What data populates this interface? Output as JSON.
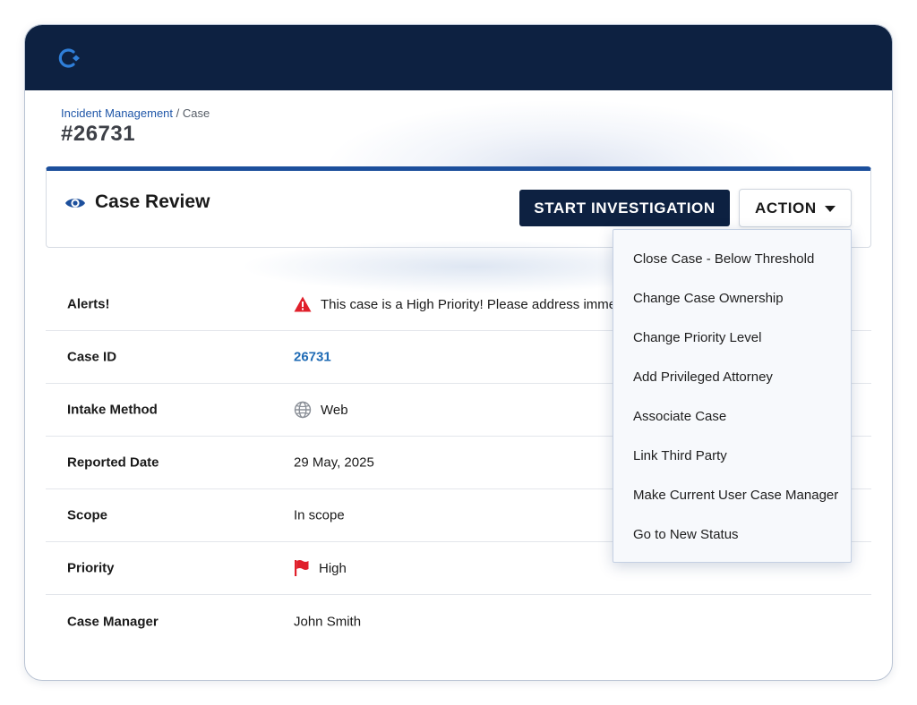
{
  "breadcrumb": {
    "parent": "Incident Management",
    "separator": "/",
    "current": "Case"
  },
  "page": {
    "title": "#26731"
  },
  "card": {
    "title": "Case Review",
    "start_label": "START INVESTIGATION",
    "action_label": "ACTION"
  },
  "fields": [
    {
      "label": "Alerts!",
      "value": "This case is a High Priority! Please address immediately.",
      "icon": "warning-triangle-icon"
    },
    {
      "label": "Case ID",
      "value": "26731",
      "icon": ""
    },
    {
      "label": "Intake Method",
      "value": "Web",
      "icon": "globe-icon"
    },
    {
      "label": "Reported Date",
      "value": "29 May, 2025",
      "icon": ""
    },
    {
      "label": "Scope",
      "value": "In scope",
      "icon": ""
    },
    {
      "label": "Priority",
      "value": "High",
      "icon": "flag-icon"
    },
    {
      "label": "Case Manager",
      "value": "John Smith",
      "icon": ""
    }
  ],
  "action_menu": [
    "Close Case - Below Threshold",
    "Change Case Ownership",
    "Change Priority Level",
    "Add Privileged Attorney",
    "Associate Case",
    "Link Third Party",
    "Make Current User Case Manager",
    "Go to New Status"
  ],
  "colors": {
    "topbar": "#0d2141",
    "accent": "#1c4f9c",
    "link": "#1f6bb5",
    "alert": "#e0202b"
  }
}
